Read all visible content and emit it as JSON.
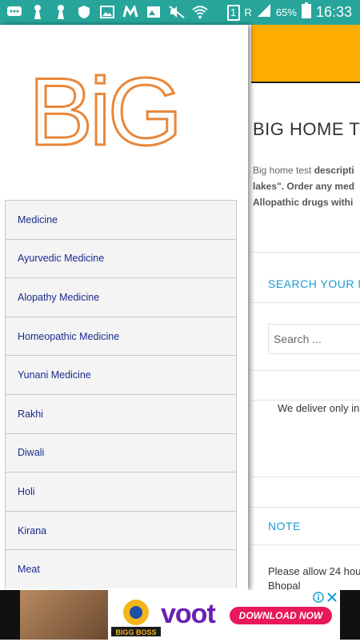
{
  "status_bar": {
    "battery_percent": "65%",
    "time": "16:33",
    "sim_slot": "1",
    "roaming": "R"
  },
  "drawer": {
    "logo_text": "BiG",
    "menu_items": [
      {
        "label": "Medicine"
      },
      {
        "label": "Ayurvedic Medicine"
      },
      {
        "label": "Alopathy Medicine"
      },
      {
        "label": "Homeopathic Medicine"
      },
      {
        "label": "Yunani Medicine"
      },
      {
        "label": "Rakhi"
      },
      {
        "label": "Diwali"
      },
      {
        "label": "Holi"
      },
      {
        "label": "Kirana"
      },
      {
        "label": "Meat"
      }
    ]
  },
  "page": {
    "title": "BIG HOME T",
    "desc_line1_plain": "Big home test ",
    "desc_line1_bold": "descripti",
    "desc_line2": "lakes\". Order any med",
    "desc_line3": "Allopathic drugs withi",
    "search_heading": "SEARCH YOUR M",
    "search_placeholder": "Search ...",
    "deliver_text": "We deliver only in",
    "note_heading": "NOTE",
    "note_text_line1": "Please allow 24 hou",
    "note_text_line2": "Bhopal"
  },
  "ad": {
    "show_name": "BIGG BOSS",
    "brand": "voot",
    "cta": "DOWNLOAD NOW",
    "info_icon": "info-icon",
    "close_icon": "close-icon"
  }
}
